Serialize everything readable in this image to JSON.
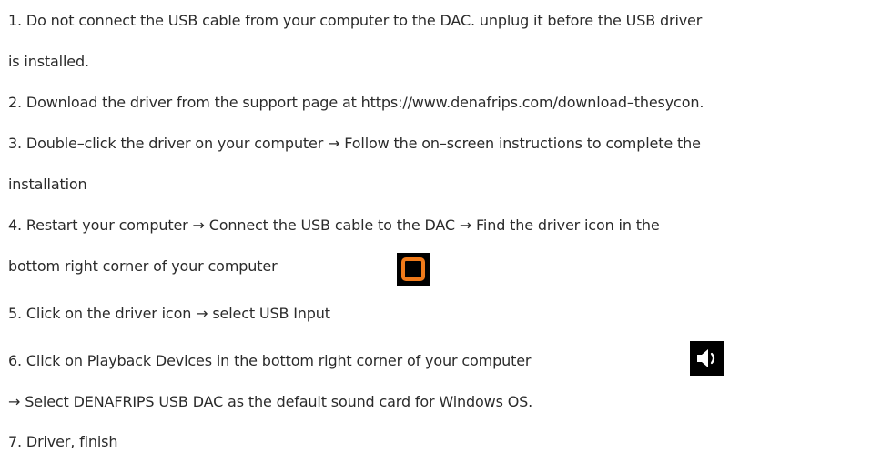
{
  "steps": {
    "l1": "1. Do not connect the USB cable from your computer to the DAC. unplug it before the USB driver",
    "l2": "is installed.",
    "l3": "2. Download the driver from the support page at https://www.denafrips.com/download–thesycon.",
    "l4": "3. Double–click the driver on your computer → Follow the on–screen instructions to complete the",
    "l5": "installation",
    "l6": "4. Restart your computer → Connect the USB cable to the DAC  →  Find the driver icon in the",
    "l7": "bottom right corner of your computer",
    "l8": "5. Click on the driver icon → select USB Input",
    "l9": "6. Click on Playback Devices in the bottom right corner of your computer",
    "l10": "→ Select DENAFRIPS USB DAC as the default sound card for Windows OS.",
    "l11": "7. Driver, finish"
  },
  "icons": {
    "driver": "driver-tray-icon",
    "speaker": "speaker-volume-icon"
  },
  "colors": {
    "text": "#2b2b2b",
    "driver_icon_accent": "#f07a1a",
    "icon_background": "#000000"
  }
}
